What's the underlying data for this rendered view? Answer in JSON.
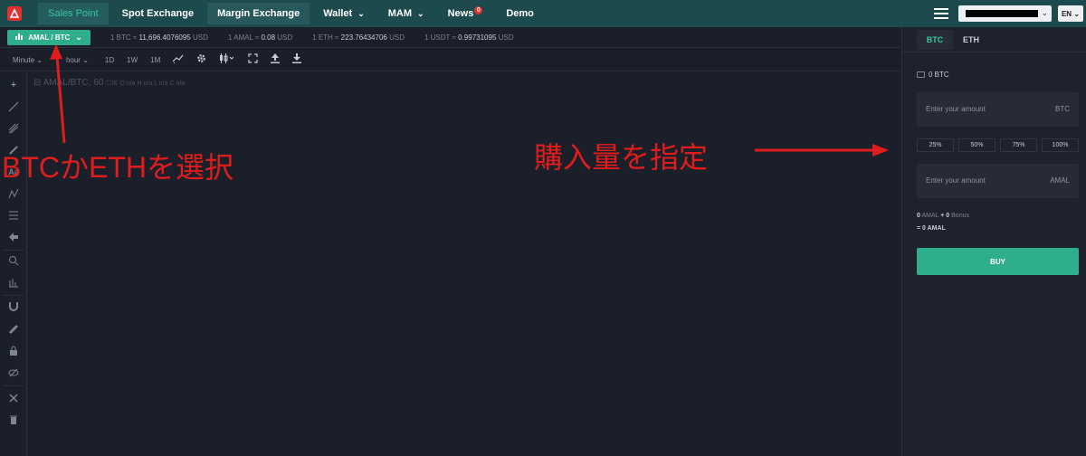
{
  "nav": {
    "tabs": [
      {
        "label": "Sales Point",
        "caret": false
      },
      {
        "label": "Spot Exchange",
        "caret": false
      },
      {
        "label": "Margin Exchange",
        "caret": false
      },
      {
        "label": "Wallet",
        "caret": true
      },
      {
        "label": "MAM",
        "caret": true
      },
      {
        "label": "News",
        "caret": false,
        "badge": "0"
      },
      {
        "label": "Demo",
        "caret": false
      }
    ],
    "language": "EN"
  },
  "ticker": {
    "pair_label": "AMAL / BTC",
    "rates": [
      {
        "unit": "1 BTC",
        "value": "11,696.4076095",
        "currency": "USD"
      },
      {
        "unit": "1 AMAL",
        "value": "0.08",
        "currency": "USD"
      },
      {
        "unit": "1 ETH",
        "value": "223.76434706",
        "currency": "USD"
      },
      {
        "unit": "1 USDT",
        "value": "0.99731095",
        "currency": "USD"
      }
    ]
  },
  "chart_toolbar": {
    "interval_unit": "Minute",
    "interval_hour": "hour",
    "ranges": [
      "1D",
      "1W",
      "1M"
    ]
  },
  "chart": {
    "legend_title": "AMAL/BTC, 60",
    "legend_ohlc": "O n/a H n/a L n/a C n/a"
  },
  "annotations": {
    "left_text": "BTCかETHを選択",
    "right_text": "購入量を指定"
  },
  "panel": {
    "tabs": [
      "BTC",
      "ETH"
    ],
    "balance": "0 BTC",
    "amount_placeholder_1": "Enter your amount",
    "amount_unit_1": "BTC",
    "percents": [
      "25%",
      "50%",
      "75%",
      "100%"
    ],
    "amount_placeholder_2": "Enter your amount",
    "amount_unit_2": "AMAL",
    "summary_amal": "0",
    "summary_amal_label": "AMAL",
    "summary_plus": "+",
    "summary_bonus": "0",
    "summary_bonus_label": "Bonus",
    "summary_eq": "=",
    "summary_total": "0 AMAL",
    "buy_label": "BUY"
  },
  "colors": {
    "accent": "#2fae8d",
    "nav_bg": "#1d4a4d",
    "annotation": "#e01d1d"
  }
}
